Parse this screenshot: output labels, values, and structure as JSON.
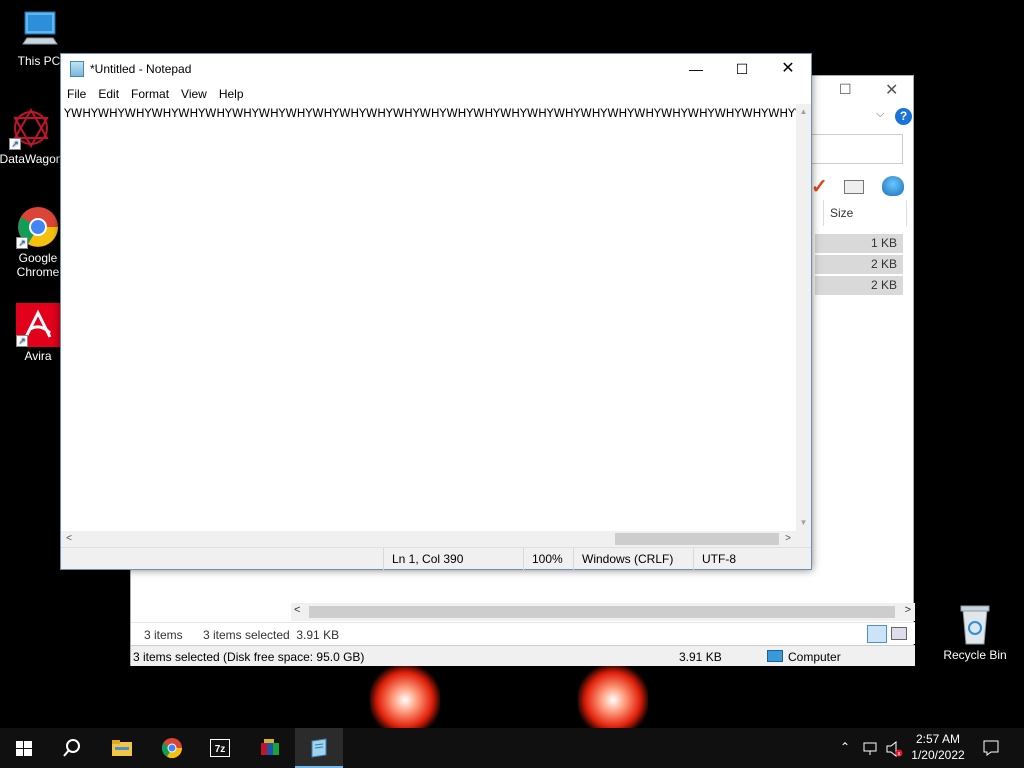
{
  "desktop": {
    "icons": [
      {
        "label": "This PC",
        "icon": "this-pc-icon"
      },
      {
        "label": "DataWagon",
        "icon": "datawagon-icon"
      },
      {
        "label": "Google Chrome",
        "icon": "chrome-icon"
      },
      {
        "label": "Avira",
        "icon": "avira-icon"
      },
      {
        "label": "Recycle Bin",
        "icon": "recycle-bin-icon"
      }
    ]
  },
  "explorer": {
    "column_size": "Size",
    "sizes": [
      "1 KB",
      "2 KB",
      "2 KB"
    ],
    "item_count": "3 items",
    "selected_info": "3 items selected  3.91 KB",
    "status_selected": "3 items selected (Disk free space: 95.0 GB)",
    "status_size": "3.91 KB",
    "status_location": "Computer"
  },
  "notepad": {
    "title": "*Untitled - Notepad",
    "menu": [
      "File",
      "Edit",
      "Format",
      "View",
      "Help"
    ],
    "text": "YWHYWHYWHYWHYWHYWHYWHYWHYWHYWHYWHYWHYWHYWHYWHYWHYWHYWHYWHYWHYWHYWHYWHYWHYWHYWHYWHYWHYWHYWHYWHYWHYWHYWHYWHY",
    "status": {
      "position": "Ln 1, Col 390",
      "zoom": "100%",
      "line_ending": "Windows (CRLF)",
      "encoding": "UTF-8"
    }
  },
  "taskbar": {
    "apps": [
      "start-icon",
      "search-icon",
      "file-explorer-icon",
      "chrome-icon",
      "7zip-icon",
      "winrar-icon",
      "notepad-icon"
    ],
    "time": "2:57 AM",
    "date": "1/20/2022"
  },
  "colors": {
    "accent": "#0078d7",
    "taskbar": "#101010",
    "desktop": "#000000"
  }
}
